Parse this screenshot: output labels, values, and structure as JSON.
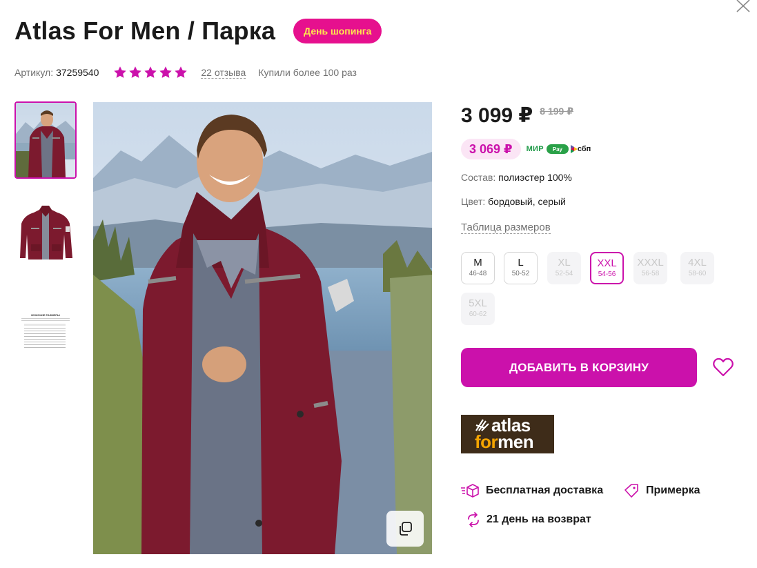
{
  "product": {
    "title": "Atlas For Men / Парка",
    "promo_badge": "День шопинга",
    "sku_label": "Артикул:",
    "sku": "37259540",
    "rating": 5,
    "reviews": "22 отзыва",
    "purchases": "Купили более 100 раз"
  },
  "gallery": {
    "thumbnails": [
      "jacket-front-model",
      "jacket-flat",
      "size-chart"
    ],
    "selected_index": 0,
    "size_chart_title": "МУЖСКИЕ РАЗМЕРЫ"
  },
  "pricing": {
    "price": "3 099 ₽",
    "old_price": "8 199 ₽",
    "wallet_price": "3 069 ₽",
    "pay_logos": [
      "МИР",
      "Pay",
      "сбп"
    ]
  },
  "specs": {
    "composition_label": "Состав:",
    "composition": "полиэстер 100%",
    "color_label": "Цвет:",
    "color": "бордовый, серый",
    "size_table_link": "Таблица размеров"
  },
  "sizes": [
    {
      "label": "M",
      "ru": "46-48",
      "state": "available"
    },
    {
      "label": "L",
      "ru": "50-52",
      "state": "available"
    },
    {
      "label": "XL",
      "ru": "52-54",
      "state": "disabled"
    },
    {
      "label": "XXL",
      "ru": "54-56",
      "state": "selected"
    },
    {
      "label": "XXXL",
      "ru": "56-58",
      "state": "disabled"
    },
    {
      "label": "4XL",
      "ru": "58-60",
      "state": "disabled"
    },
    {
      "label": "5XL",
      "ru": "60-62",
      "state": "disabled"
    }
  ],
  "actions": {
    "add_to_cart": "ДОБАВИТЬ В КОРЗИНУ"
  },
  "brand": {
    "logo_line1": "atlas",
    "logo_line2a": "for",
    "logo_line2b": "men"
  },
  "benefits": {
    "delivery": "Бесплатная доставка",
    "fitting": "Примерка",
    "returns": "21 день на возврат"
  },
  "colors": {
    "accent": "#cb11ab",
    "promo_bg": "#e6108e",
    "promo_text": "#ffe94d",
    "wallet_bg": "#fbe5f5",
    "jacket": "#7c1a2e"
  }
}
